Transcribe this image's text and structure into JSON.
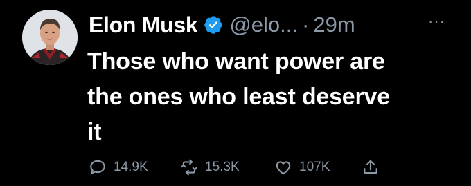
{
  "author": {
    "display_name": "Elon Musk",
    "handle": "@elo...",
    "verified": true,
    "verified_color": "#1d9bf0"
  },
  "meta": {
    "separator": "·",
    "time": "29m",
    "more_label": "···"
  },
  "tweet": {
    "lines": [
      "Those who want power are",
      "the ones who least deserve",
      "it"
    ]
  },
  "actions": {
    "replies": "14.9K",
    "retweets": "15.3K",
    "likes": "107K",
    "reply_icon": "reply-icon",
    "retweet_icon": "retweet-icon",
    "like_icon": "heart-icon",
    "share_icon": "share-icon"
  },
  "theme": {
    "background": "#000000",
    "text": "#ffffff",
    "muted": "#8b98a5"
  }
}
